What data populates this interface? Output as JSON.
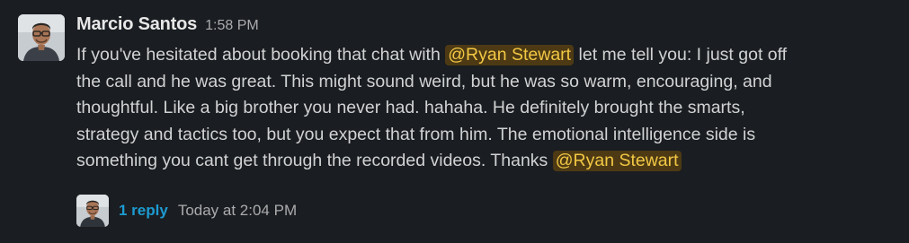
{
  "message": {
    "sender": "Marcio Santos",
    "time": "1:58 PM",
    "lines": [
      {
        "before": "If you've hesitated about booking that chat with ",
        "mention": "@Ryan Stewart",
        "after": " let me tell you: I just got off"
      },
      {
        "text": "the call and he was great. This might sound weird, but he was so warm, encouraging, and"
      },
      {
        "text": "thoughtful. Like a big brother you never had. hahaha. He definitely brought the smarts,"
      },
      {
        "text": "strategy and tactics too, but you expect that from him. The emotional intelligence side is"
      },
      {
        "before": "something you cant get through the recorded videos. Thanks ",
        "mention": "@Ryan Stewart"
      }
    ]
  },
  "thread": {
    "reply_count": "1 reply",
    "last_reply": "Today at 2:04 PM"
  },
  "colors": {
    "background": "#1a1d21",
    "mention_bg": "#4d3a14",
    "mention_text": "#f2c744",
    "link": "#1d9bd1"
  },
  "icons": {
    "sender_avatar": "avatar-man-glasses-photo",
    "thread_avatar": "avatar-man-glasses-photo"
  }
}
